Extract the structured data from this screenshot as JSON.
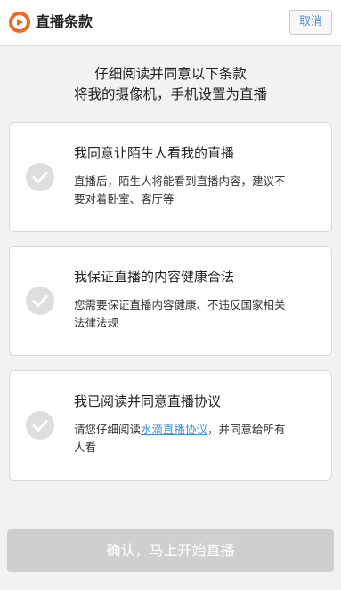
{
  "header": {
    "title": "直播条款",
    "cancel_label": "取消"
  },
  "intro": {
    "line1": "仔细阅读并同意以下条款",
    "line2": "将我的摄像机，手机设置为直播"
  },
  "terms": [
    {
      "title": "我同意让陌生人看我的直播",
      "desc_line1": "直播后，陌生人将能看到直播内容，建议不",
      "desc_line2": "要对着卧室、客厅等"
    },
    {
      "title": "我保证直播的内容健康合法",
      "desc_line1": "您需要保证直播内容健康、不违反国家相关",
      "desc_line2": "法律法规"
    },
    {
      "title": "我已阅读并同意直播协议",
      "desc_prefix": "请您仔细阅读",
      "desc_link": "水滴直播协议",
      "desc_suffix": "，并同意给所有",
      "desc_line2": "人看"
    }
  ],
  "confirm_label": "确认，马上开始直播",
  "colors": {
    "brand": "#ee6a1f",
    "link": "#3f8fd6",
    "check_disabled": "#dedede",
    "confirm_disabled": "#cfcfcf"
  },
  "icons": [
    "app-logo-icon",
    "check-icon"
  ]
}
